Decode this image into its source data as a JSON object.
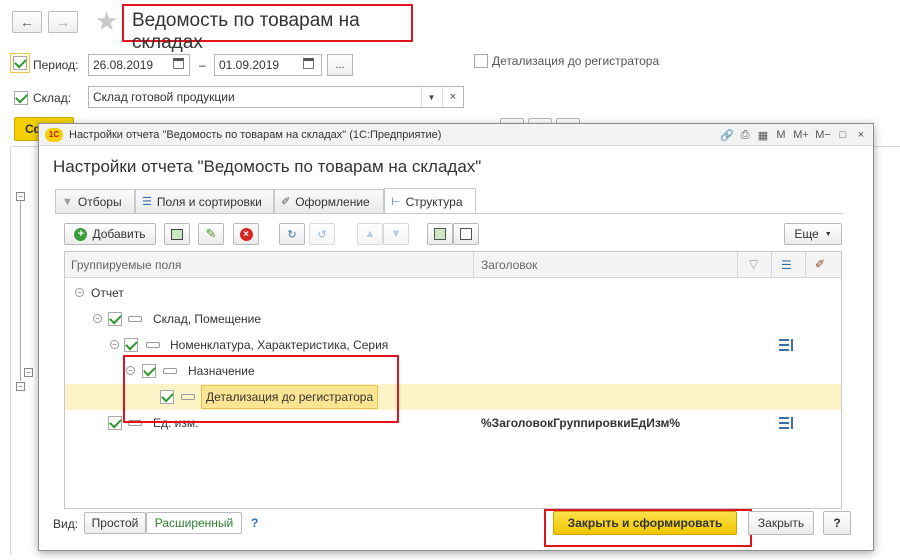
{
  "main": {
    "title": "Ведомость по товарам на складах",
    "period_label": "Период:",
    "date_from": "26.08.2019",
    "date_sep": "–",
    "date_to": "01.09.2019",
    "ellipsis": "...",
    "detail_reg_label": "Детализация до регистратора",
    "warehouse_label": "Склад:",
    "warehouse_value": "Склад готовой продукции",
    "form_btn_fragment": "Сф"
  },
  "dialog": {
    "window_title": "Настройки отчета \"Ведомость по товарам на складах\" (1С:Предприятие)",
    "onec_badge": "1С",
    "heading": "Настройки отчета \"Ведомость по товарам на складах\"",
    "tabs": [
      {
        "label": "Отборы"
      },
      {
        "label": "Поля и сортировки"
      },
      {
        "label": "Оформление"
      },
      {
        "label": "Структура"
      }
    ],
    "toolbar": {
      "add_label": "Добавить",
      "more_label": "Еще"
    },
    "grid": {
      "col_fields": "Группируемые поля",
      "col_title": "Заголовок"
    },
    "tree": [
      {
        "label": "Отчет",
        "title": ""
      },
      {
        "label": "Склад, Помещение",
        "title": ""
      },
      {
        "label": "Номенклатура, Характеристика, Серия",
        "title": ""
      },
      {
        "label": "Назначение",
        "title": ""
      },
      {
        "label": "Детализация до регистратора",
        "title": ""
      },
      {
        "label": "Ед. изм.",
        "title": "%ЗаголовокГруппировкиЕдИзм%"
      }
    ],
    "view_label": "Вид:",
    "view_simple": "Простой",
    "view_extended": "Расширенный",
    "help": "?",
    "close_and_build": "Закрыть и сформировать",
    "close": "Закрыть",
    "help_btn": "?"
  },
  "colors": {
    "highlight_red": "#e3131d",
    "selected_row": "#fdf3c8",
    "yellow_button": "#f5d000",
    "check_green": "#2e9a2e"
  }
}
